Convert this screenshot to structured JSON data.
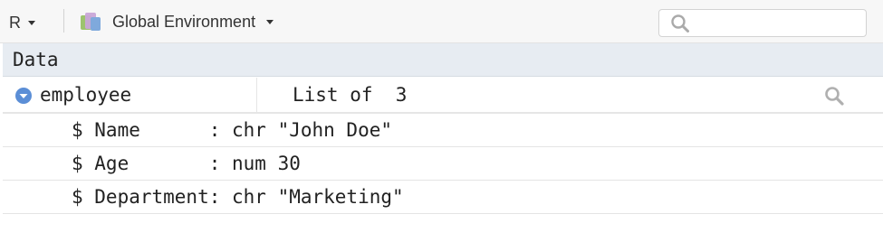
{
  "toolbar": {
    "language": "R",
    "environment": "Global Environment",
    "search_placeholder": ""
  },
  "section_header": "Data",
  "object": {
    "name": "employee",
    "value": "List of  3"
  },
  "fields": [
    {
      "text": "$ Name      : chr \"John Doe\""
    },
    {
      "text": "$ Age       : num 30"
    },
    {
      "text": "$ Department: chr \"Marketing\""
    }
  ],
  "colors": {
    "expander": "#5b8ed6",
    "section_bg": "#e7ecf2",
    "toolbar_bg": "#f7f7f7"
  }
}
